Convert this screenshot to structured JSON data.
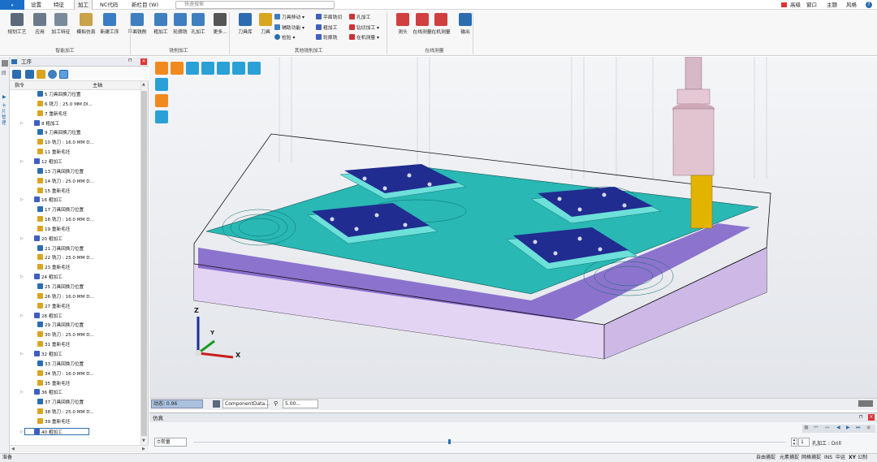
{
  "menubar": {
    "file_label": "",
    "tabs": [
      "设置",
      "特征",
      "加工",
      "NC代码",
      "新栏目 (W)"
    ],
    "active_tab": "加工",
    "search_placeholder": "快速搜索",
    "right_items": [
      "高级",
      "窗口",
      "主题",
      "风格"
    ]
  },
  "ribbon": {
    "groups": [
      {
        "label": "智能加工"
      },
      {
        "label": "铣削加工"
      },
      {
        "label": "其他铣削加工"
      },
      {
        "label": "在线测量"
      }
    ],
    "buttons": [
      {
        "label": "规划工艺",
        "color": "#5a6a7a"
      },
      {
        "label": "应用",
        "color": "#6a7a8a"
      },
      {
        "label": "加工特征",
        "color": "#7a8a9a"
      },
      {
        "label": "模拟仿真",
        "color": "#c9a24a"
      },
      {
        "label": "新建工序",
        "color": "#3b7dc4"
      },
      {
        "label": "平面铣削",
        "color": "#3f7fbf"
      },
      {
        "label": "粗加工",
        "color": "#3f7fbf"
      },
      {
        "label": "轮廓铣",
        "color": "#3f7fbf"
      },
      {
        "label": "孔加工",
        "color": "#3f7fbf"
      },
      {
        "label": "更多...",
        "color": "#555"
      },
      {
        "label": "刀具库",
        "color": "#2c6db0"
      },
      {
        "label": "刀具",
        "color": "#d9a520"
      },
      {
        "label": "测头",
        "color": "#d04040"
      },
      {
        "label": "在线测量",
        "color": "#d04040"
      },
      {
        "label": "在机测量",
        "color": "#d04040"
      },
      {
        "label": "输出",
        "color": "#2c6db0"
      }
    ],
    "small": [
      "刀具移动",
      "辅助功能",
      "检验",
      "平面铣切",
      "粗加工",
      "轮廓铣",
      "孔加工",
      "钻切加工",
      "在机测量"
    ]
  },
  "panel": {
    "title": "工序",
    "col_cmd": "指令",
    "col_main": "主轴",
    "rows": [
      {
        "t": "5 刀具回换刀位置",
        "ic": "#2c6db0",
        "ind": 1
      },
      {
        "t": "6 铣刀 : 25.0 MM Dl...",
        "ic": "#d9a520",
        "ind": 1
      },
      {
        "t": "7 重新毛坯",
        "ic": "#d9a520",
        "ind": 1
      },
      {
        "t": "8 粗加工",
        "ic": "#3f5fbf",
        "ind": 0
      },
      {
        "t": "9 刀具回换刀位置",
        "ic": "#2c6db0",
        "ind": 1
      },
      {
        "t": "10 铣刀 : 16.0 MM D...",
        "ic": "#d9a520",
        "ind": 1
      },
      {
        "t": "11 重新毛坯",
        "ic": "#d9a520",
        "ind": 1
      },
      {
        "t": "12 粗加工",
        "ic": "#3f5fbf",
        "ind": 0
      },
      {
        "t": "13 刀具回换刀位置",
        "ic": "#2c6db0",
        "ind": 1
      },
      {
        "t": "14 铣刀 : 25.0 MM D...",
        "ic": "#d9a520",
        "ind": 1
      },
      {
        "t": "15 重新毛坯",
        "ic": "#d9a520",
        "ind": 1
      },
      {
        "t": "16 粗加工",
        "ic": "#3f5fbf",
        "ind": 0
      },
      {
        "t": "17 刀具回换刀位置",
        "ic": "#2c6db0",
        "ind": 1
      },
      {
        "t": "18 铣刀 : 16.0 MM D...",
        "ic": "#d9a520",
        "ind": 1
      },
      {
        "t": "19 重新毛坯",
        "ic": "#d9a520",
        "ind": 1
      },
      {
        "t": "20 粗加工",
        "ic": "#3f5fbf",
        "ind": 0
      },
      {
        "t": "21 刀具回换刀位置",
        "ic": "#2c6db0",
        "ind": 1
      },
      {
        "t": "22 铣刀 : 25.0 MM D...",
        "ic": "#d9a520",
        "ind": 1
      },
      {
        "t": "23 重新毛坯",
        "ic": "#d9a520",
        "ind": 1
      },
      {
        "t": "24 粗加工",
        "ic": "#3f5fbf",
        "ind": 0
      },
      {
        "t": "25 刀具回换刀位置",
        "ic": "#2c6db0",
        "ind": 1
      },
      {
        "t": "26 铣刀 : 16.0 MM D...",
        "ic": "#d9a520",
        "ind": 1
      },
      {
        "t": "27 重新毛坯",
        "ic": "#d9a520",
        "ind": 1
      },
      {
        "t": "28 粗加工",
        "ic": "#3f5fbf",
        "ind": 0
      },
      {
        "t": "29 刀具回换刀位置",
        "ic": "#2c6db0",
        "ind": 1
      },
      {
        "t": "30 铣刀 : 25.0 MM D...",
        "ic": "#d9a520",
        "ind": 1
      },
      {
        "t": "31 重新毛坯",
        "ic": "#d9a520",
        "ind": 1
      },
      {
        "t": "32 粗加工",
        "ic": "#3f5fbf",
        "ind": 0
      },
      {
        "t": "33 刀具回换刀位置",
        "ic": "#2c6db0",
        "ind": 1
      },
      {
        "t": "34 铣刀 : 16.0 MM D...",
        "ic": "#d9a520",
        "ind": 1
      },
      {
        "t": "35 重新毛坯",
        "ic": "#d9a520",
        "ind": 1
      },
      {
        "t": "36 粗加工",
        "ic": "#3f5fbf",
        "ind": 0
      },
      {
        "t": "37 刀具回换刀位置",
        "ic": "#2c6db0",
        "ind": 1
      },
      {
        "t": "38 铣刀 : 25.0 MM D...",
        "ic": "#d9a520",
        "ind": 1
      },
      {
        "t": "39 重新毛坯",
        "ic": "#d9a520",
        "ind": 1
      },
      {
        "t": "40 粗加工",
        "ic": "#3f5fbf",
        "ind": 0,
        "selected": true
      }
    ]
  },
  "viewport": {
    "axes": {
      "x": "X",
      "y": "Y",
      "z": "Z"
    }
  },
  "vstatus": {
    "anim": "动态: 0.96",
    "component": "ComponentData...",
    "value": "5.00..."
  },
  "sim": {
    "title": "仿真",
    "mode": "常量",
    "progress": 0.43,
    "step": "1",
    "op": "孔加工 : Drill"
  },
  "statusbar": {
    "left": "准备",
    "right": [
      "自由捕捉",
      "元素捕捉",
      "网格捕捉",
      "INS",
      "中运",
      "XY",
      "公制"
    ]
  }
}
